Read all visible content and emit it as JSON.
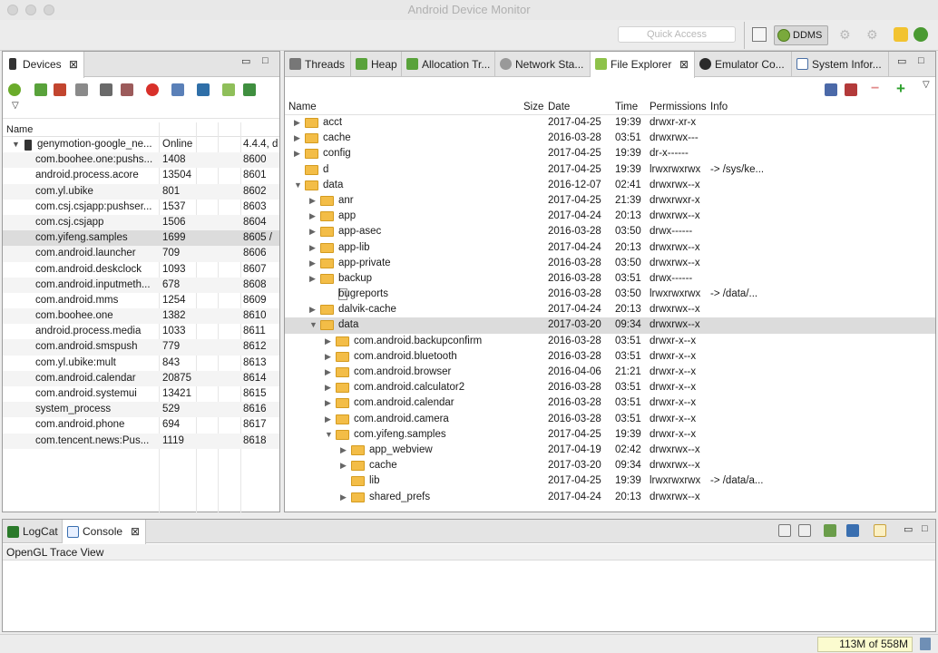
{
  "window": {
    "title": "Android Device Monitor"
  },
  "toolbar": {
    "quick_access_placeholder": "Quick Access",
    "perspective_label": "DDMS"
  },
  "devices_view": {
    "tab_label": "Devices",
    "column_name": "Name",
    "device": {
      "name": "genymotion-google_ne...",
      "status": "Online",
      "version": "4.4.4, d"
    },
    "processes": [
      {
        "name": "com.boohee.one:pushs...",
        "pid": "1408",
        "port": "8600"
      },
      {
        "name": "android.process.acore",
        "pid": "13504",
        "port": "8601"
      },
      {
        "name": "com.yl.ubike",
        "pid": "801",
        "port": "8602"
      },
      {
        "name": "com.csj.csjapp:pushser...",
        "pid": "1537",
        "port": "8603"
      },
      {
        "name": "com.csj.csjapp",
        "pid": "1506",
        "port": "8604"
      },
      {
        "name": "com.yifeng.samples",
        "pid": "1699",
        "port": "8605 /"
      },
      {
        "name": "com.android.launcher",
        "pid": "709",
        "port": "8606"
      },
      {
        "name": "com.android.deskclock",
        "pid": "1093",
        "port": "8607"
      },
      {
        "name": "com.android.inputmeth...",
        "pid": "678",
        "port": "8608"
      },
      {
        "name": "com.android.mms",
        "pid": "1254",
        "port": "8609"
      },
      {
        "name": "com.boohee.one",
        "pid": "1382",
        "port": "8610"
      },
      {
        "name": "android.process.media",
        "pid": "1033",
        "port": "8611"
      },
      {
        "name": "com.android.smspush",
        "pid": "779",
        "port": "8612"
      },
      {
        "name": "com.yl.ubike:mult",
        "pid": "843",
        "port": "8613"
      },
      {
        "name": "com.android.calendar",
        "pid": "20875",
        "port": "8614"
      },
      {
        "name": "com.android.systemui",
        "pid": "13421",
        "port": "8615"
      },
      {
        "name": "system_process",
        "pid": "529",
        "port": "8616"
      },
      {
        "name": "com.android.phone",
        "pid": "694",
        "port": "8617"
      },
      {
        "name": "com.tencent.news:Pus...",
        "pid": "1119",
        "port": "8618"
      }
    ]
  },
  "view_tabs": {
    "threads": "Threads",
    "heap": "Heap",
    "allocation": "Allocation Tr...",
    "network": "Network Sta...",
    "file_explorer": "File Explorer",
    "emulator": "Emulator Co...",
    "system_info": "System Infor..."
  },
  "file_explorer": {
    "columns": {
      "name": "Name",
      "size": "Size",
      "date": "Date",
      "time": "Time",
      "permissions": "Permissions",
      "info": "Info"
    },
    "rows": [
      {
        "name": "acct",
        "type": "folder",
        "depth": 0,
        "arrow": "right",
        "date": "2017-04-25",
        "time": "19:39",
        "perm": "drwxr-xr-x",
        "info": ""
      },
      {
        "name": "cache",
        "type": "folder",
        "depth": 0,
        "arrow": "right",
        "date": "2016-03-28",
        "time": "03:51",
        "perm": "drwxrwx---",
        "info": ""
      },
      {
        "name": "config",
        "type": "folder",
        "depth": 0,
        "arrow": "right",
        "date": "2017-04-25",
        "time": "19:39",
        "perm": "dr-x------",
        "info": ""
      },
      {
        "name": "d",
        "type": "folder",
        "depth": 0,
        "arrow": "none",
        "date": "2017-04-25",
        "time": "19:39",
        "perm": "lrwxrwxrwx",
        "info": "-> /sys/ke..."
      },
      {
        "name": "data",
        "type": "folder",
        "depth": 0,
        "arrow": "down",
        "date": "2016-12-07",
        "time": "02:41",
        "perm": "drwxrwx--x",
        "info": ""
      },
      {
        "name": "anr",
        "type": "folder",
        "depth": 1,
        "arrow": "right",
        "date": "2017-04-25",
        "time": "21:39",
        "perm": "drwxrwxr-x",
        "info": ""
      },
      {
        "name": "app",
        "type": "folder",
        "depth": 1,
        "arrow": "right",
        "date": "2017-04-24",
        "time": "20:13",
        "perm": "drwxrwx--x",
        "info": ""
      },
      {
        "name": "app-asec",
        "type": "folder",
        "depth": 1,
        "arrow": "right",
        "date": "2016-03-28",
        "time": "03:50",
        "perm": "drwx------",
        "info": ""
      },
      {
        "name": "app-lib",
        "type": "folder",
        "depth": 1,
        "arrow": "right",
        "date": "2017-04-24",
        "time": "20:13",
        "perm": "drwxrwx--x",
        "info": ""
      },
      {
        "name": "app-private",
        "type": "folder",
        "depth": 1,
        "arrow": "right",
        "date": "2016-03-28",
        "time": "03:50",
        "perm": "drwxrwx--x",
        "info": ""
      },
      {
        "name": "backup",
        "type": "folder",
        "depth": 1,
        "arrow": "right",
        "date": "2016-03-28",
        "time": "03:51",
        "perm": "drwx------",
        "info": ""
      },
      {
        "name": "bugreports",
        "type": "file",
        "depth": 1,
        "arrow": "none",
        "date": "2016-03-28",
        "time": "03:50",
        "perm": "lrwxrwxrwx",
        "info": "-> /data/..."
      },
      {
        "name": "dalvik-cache",
        "type": "folder",
        "depth": 1,
        "arrow": "right",
        "date": "2017-04-24",
        "time": "20:13",
        "perm": "drwxrwx--x",
        "info": ""
      },
      {
        "name": "data",
        "type": "folder",
        "depth": 1,
        "arrow": "down",
        "date": "2017-03-20",
        "time": "09:34",
        "perm": "drwxrwx--x",
        "info": "",
        "selected": true
      },
      {
        "name": "com.android.backupconfirm",
        "type": "folder",
        "depth": 2,
        "arrow": "right",
        "date": "2016-03-28",
        "time": "03:51",
        "perm": "drwxr-x--x",
        "info": ""
      },
      {
        "name": "com.android.bluetooth",
        "type": "folder",
        "depth": 2,
        "arrow": "right",
        "date": "2016-03-28",
        "time": "03:51",
        "perm": "drwxr-x--x",
        "info": ""
      },
      {
        "name": "com.android.browser",
        "type": "folder",
        "depth": 2,
        "arrow": "right",
        "date": "2016-04-06",
        "time": "21:21",
        "perm": "drwxr-x--x",
        "info": ""
      },
      {
        "name": "com.android.calculator2",
        "type": "folder",
        "depth": 2,
        "arrow": "right",
        "date": "2016-03-28",
        "time": "03:51",
        "perm": "drwxr-x--x",
        "info": ""
      },
      {
        "name": "com.android.calendar",
        "type": "folder",
        "depth": 2,
        "arrow": "right",
        "date": "2016-03-28",
        "time": "03:51",
        "perm": "drwxr-x--x",
        "info": ""
      },
      {
        "name": "com.android.camera",
        "type": "folder",
        "depth": 2,
        "arrow": "right",
        "date": "2016-03-28",
        "time": "03:51",
        "perm": "drwxr-x--x",
        "info": ""
      },
      {
        "name": "com.yifeng.samples",
        "type": "folder",
        "depth": 2,
        "arrow": "down",
        "date": "2017-04-25",
        "time": "19:39",
        "perm": "drwxr-x--x",
        "info": ""
      },
      {
        "name": "app_webview",
        "type": "folder",
        "depth": 3,
        "arrow": "right",
        "date": "2017-04-19",
        "time": "02:42",
        "perm": "drwxrwx--x",
        "info": ""
      },
      {
        "name": "cache",
        "type": "folder",
        "depth": 3,
        "arrow": "right",
        "date": "2017-03-20",
        "time": "09:34",
        "perm": "drwxrwx--x",
        "info": ""
      },
      {
        "name": "lib",
        "type": "folder",
        "depth": 3,
        "arrow": "none",
        "date": "2017-04-25",
        "time": "19:39",
        "perm": "lrwxrwxrwx",
        "info": "-> /data/a..."
      },
      {
        "name": "shared_prefs",
        "type": "folder",
        "depth": 3,
        "arrow": "right",
        "date": "2017-04-24",
        "time": "20:13",
        "perm": "drwxrwx--x",
        "info": ""
      }
    ]
  },
  "console_view": {
    "logcat_tab": "LogCat",
    "console_tab": "Console",
    "content_title": "OpenGL Trace View"
  },
  "status_bar": {
    "memory": "113M of 558M"
  },
  "colors": {
    "folder": "#f3bd47",
    "selection": "#dcdcdc",
    "memory_bg": "#fbfbcf",
    "android_green": "#7aa93c"
  }
}
